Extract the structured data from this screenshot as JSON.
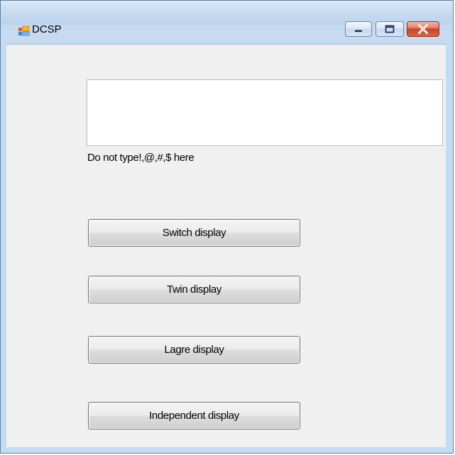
{
  "window": {
    "title": "DCSP",
    "controls": {
      "minimize_icon": "minimize-icon",
      "maximize_icon": "maximize-icon",
      "close_icon": "close-icon"
    }
  },
  "form": {
    "input_value": "",
    "hint": "Do not type!,@,#,$ here",
    "buttons": {
      "switch": "Switch display",
      "twin": "Twin display",
      "large": "Lagre display",
      "independent": "Independent display"
    }
  },
  "colors": {
    "title_bar": "#c7dbf0",
    "client_bg": "#f0f0f0",
    "close_button": "#c8442a"
  }
}
